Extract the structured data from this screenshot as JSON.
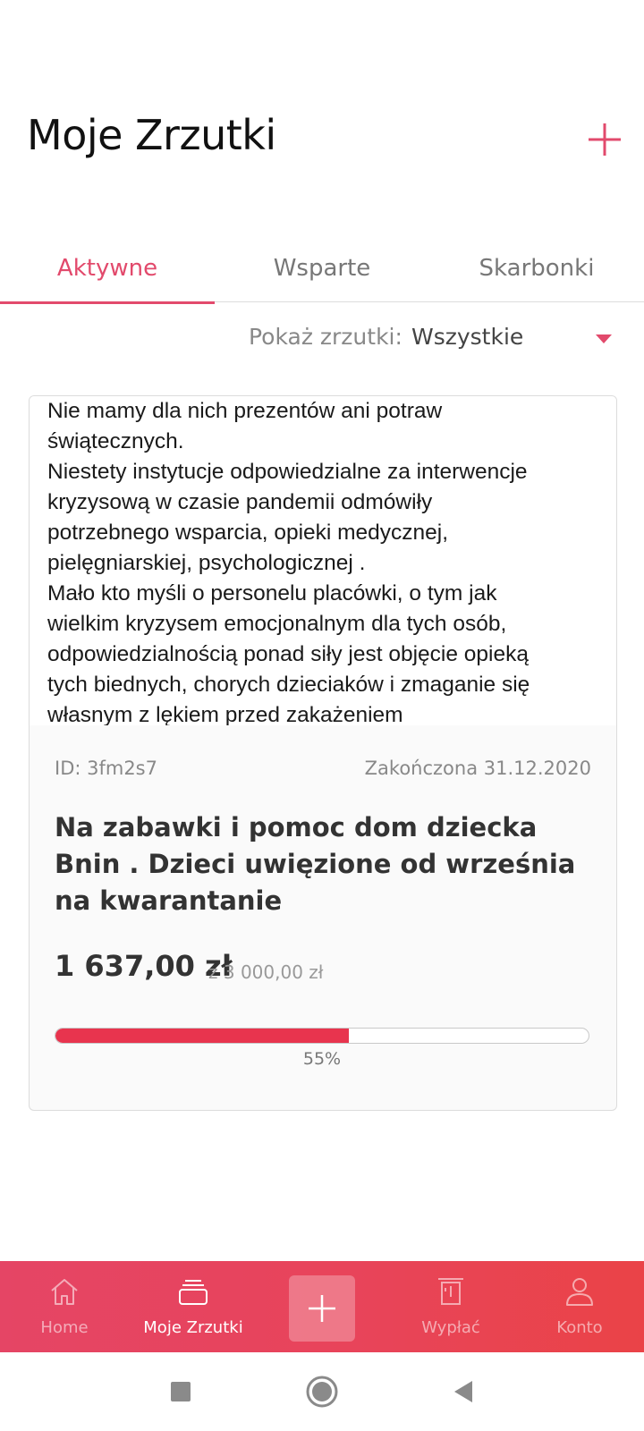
{
  "header": {
    "title": "Moje Zrzutki",
    "add_icon": "plus-icon",
    "accent_color": "#e24a6c"
  },
  "tabs": [
    {
      "label": "Aktywne",
      "active": true
    },
    {
      "label": "Wsparte",
      "active": false
    },
    {
      "label": "Skarbonki",
      "active": false
    }
  ],
  "filter": {
    "label": "Pokaż zrzutki:",
    "value": "Wszystkie",
    "caret_icon": "caret-down-icon"
  },
  "fundraiser": {
    "image_text": "Nie mamy dla nich prezentów ani potraw\nświątecznych.\nNiestety instytucje odpowiedzialne za interwencje\nkryzysową w czasie pandemii odmówiły\npotrzebnego wsparcia, opieki medycznej,\npielęgniarskiej, psychologicznej .\nMało kto myśli o personelu placówki, o tym jak\nwielkim kryzysem emocjonalnym  dla tych osób,\nodpowiedzialnością ponad siły jest objęcie opieką\ntych biednych, chorych dzieciaków i zmaganie się\nwłasnym z lękiem przed zakażeniem",
    "id": "ID: 3fm2s7",
    "status": "Zakończona 31.12.2020",
    "title": "Na zabawki i pomoc dom dziecka Bnin . Dzieci uwięzione od września na kwarantanie",
    "amount": "1 637,00 zł",
    "goal": "z 3 000,00 zł",
    "progress_percent": 55,
    "progress_label": "55%",
    "progress_color": "#e8344e"
  },
  "bottom_nav": [
    {
      "label": "Home",
      "icon": "home-icon",
      "active": false
    },
    {
      "label": "Moje Zrzutki",
      "icon": "stack-icon",
      "active": true
    },
    {
      "label": "",
      "icon": "plus-icon",
      "active": false
    },
    {
      "label": "Wypłać",
      "icon": "withdraw-icon",
      "active": false
    },
    {
      "label": "Konto",
      "icon": "user-icon",
      "active": false
    }
  ],
  "system_nav": [
    "recents-icon",
    "home-circle-icon",
    "back-icon"
  ]
}
